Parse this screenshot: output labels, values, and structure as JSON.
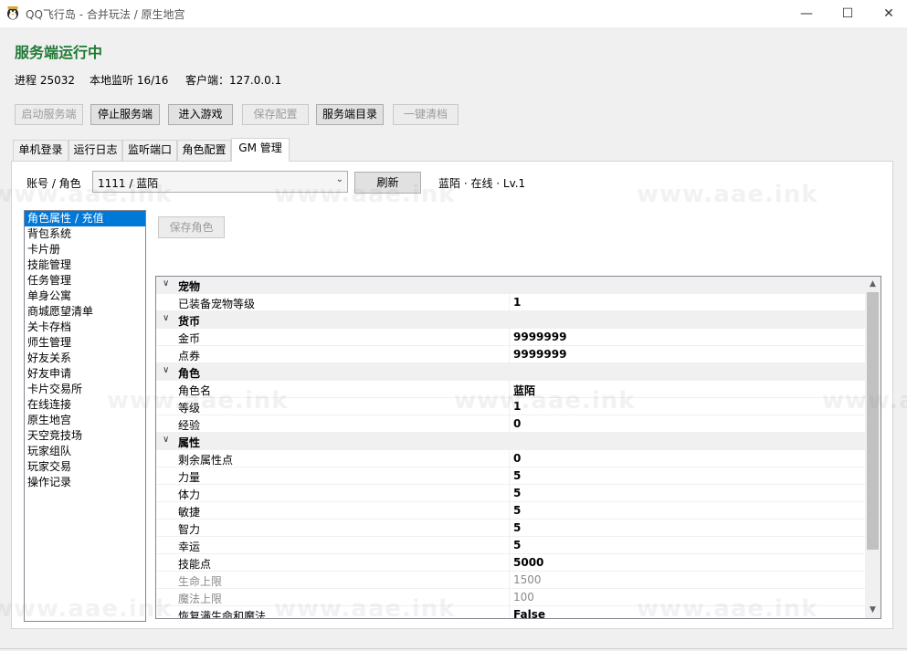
{
  "window": {
    "title": "QQ飞行岛 - 合并玩法 / 原生地宫",
    "minimize": "—",
    "maximize": "☐",
    "close": "✕"
  },
  "status": {
    "title": "服务端运行中",
    "process": "进程 25032",
    "listen": "本地监听 16/16",
    "client": "客户端：127.0.0.1"
  },
  "toolbar": {
    "start": "启动服务端",
    "stop": "停止服务端",
    "enter": "进入游戏",
    "save_config": "保存配置",
    "server_dir": "服务端目录",
    "clean": "一键清档"
  },
  "tabs": [
    "单机登录",
    "运行日志",
    "监听端口",
    "角色配置",
    "GM 管理"
  ],
  "gm": {
    "account_label": "账号 / 角色",
    "account_value": "1111 / 蓝陌",
    "refresh": "刷新",
    "summary": "蓝陌 · 在线 · Lv.1",
    "save_role": "保存角色"
  },
  "categories_list": [
    "角色属性 / 充值",
    "背包系统",
    "卡片册",
    "技能管理",
    "任务管理",
    "单身公寓",
    "商城愿望清单",
    "关卡存档",
    "师生管理",
    "好友关系",
    "好友申请",
    "卡片交易所",
    "在线连接",
    "原生地宫",
    "天空竞技场",
    "玩家组队",
    "玩家交易",
    "操作记录"
  ],
  "property_groups": [
    {
      "name": "宠物",
      "items": [
        {
          "name": "已装备宠物等级",
          "value": "1"
        }
      ]
    },
    {
      "name": "货币",
      "items": [
        {
          "name": "金币",
          "value": "9999999"
        },
        {
          "name": "点券",
          "value": "9999999"
        }
      ]
    },
    {
      "name": "角色",
      "items": [
        {
          "name": "角色名",
          "value": "蓝陌"
        },
        {
          "name": "等级",
          "value": "1"
        },
        {
          "name": "经验",
          "value": "0"
        }
      ]
    },
    {
      "name": "属性",
      "items": [
        {
          "name": "剩余属性点",
          "value": "0"
        },
        {
          "name": "力量",
          "value": "5"
        },
        {
          "name": "体力",
          "value": "5"
        },
        {
          "name": "敏捷",
          "value": "5"
        },
        {
          "name": "智力",
          "value": "5"
        },
        {
          "name": "幸运",
          "value": "5"
        },
        {
          "name": "技能点",
          "value": "5000"
        },
        {
          "name": "生命上限",
          "value": "1500",
          "readonly": true
        },
        {
          "name": "魔法上限",
          "value": "100",
          "readonly": true
        },
        {
          "name": "恢复满生命和魔法",
          "value": "False"
        }
      ]
    }
  ],
  "watermark": "www.aae.ink",
  "colors": {
    "status_green": "#1e7a35",
    "selection_blue": "#0078d7"
  }
}
